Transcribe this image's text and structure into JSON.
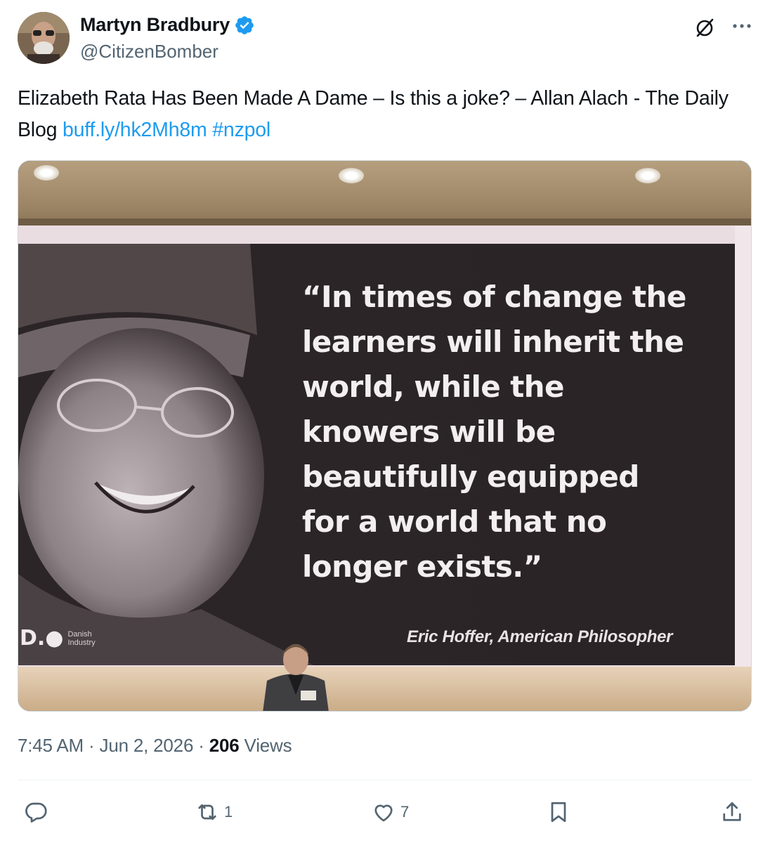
{
  "author": {
    "name": "Martyn Bradbury",
    "handle": "@CitizenBomber",
    "verified": true
  },
  "tweet": {
    "text_plain": "Elizabeth Rata Has Been Made A Dame – Is this a joke? – Allan Alach - The Daily Blog ",
    "link": "buff.ly/hk2Mh8m",
    "hashtag": "#nzpol"
  },
  "media": {
    "quote": "“In times of change the\nlearners will inherit the\nworld, while the\nknowers will be\nbeautifully equipped\nfor a world that no\nlonger exists.”",
    "attribution": "Eric Hoffer, American Philosopher",
    "logo_mark": "D.●",
    "logo_text": "Danish\nIndustry"
  },
  "meta": {
    "time": "7:45 AM",
    "sep1": " · ",
    "date": "Jun 2, 2026",
    "sep2": " · ",
    "views_count": "206",
    "views_label": " Views"
  },
  "actions": {
    "reply_count": "",
    "retweet_count": "1",
    "like_count": "7"
  },
  "colors": {
    "link": "#1d9bf0",
    "secondary_text": "#536471",
    "verified_badge": "#1d9bf0"
  },
  "icons": [
    "verified-badge-icon",
    "grok-icon",
    "more-icon",
    "reply-icon",
    "retweet-icon",
    "like-icon",
    "bookmark-icon",
    "share-icon"
  ]
}
